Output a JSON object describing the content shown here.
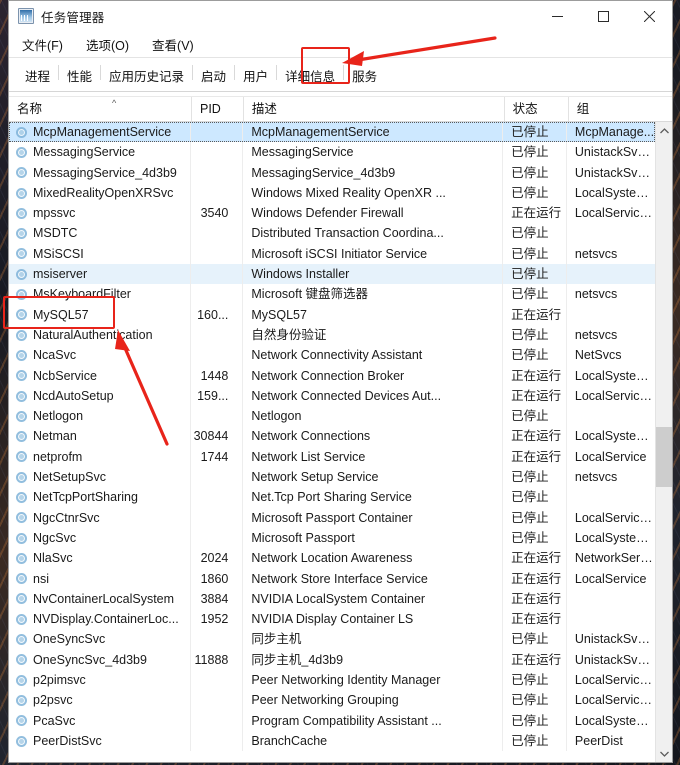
{
  "window": {
    "title": "任务管理器",
    "icon": "task-manager-icon",
    "minimize_label": "最小化",
    "maximize_label": "最大化",
    "close_label": "关闭"
  },
  "menubar": [
    {
      "label": "文件(F)"
    },
    {
      "label": "选项(O)"
    },
    {
      "label": "查看(V)"
    }
  ],
  "tabs": [
    {
      "label": "进程",
      "selected": false
    },
    {
      "label": "性能",
      "selected": false
    },
    {
      "label": "应用历史记录",
      "selected": false
    },
    {
      "label": "启动",
      "selected": false
    },
    {
      "label": "用户",
      "selected": false
    },
    {
      "label": "详细信息",
      "selected": false
    },
    {
      "label": "服务",
      "selected": true
    }
  ],
  "annotations": {
    "color": "#e8241a",
    "tab_box_target": "服务",
    "row_box_target": "MySQL57"
  },
  "table": {
    "columns": [
      {
        "key": "name",
        "label": "名称",
        "sort": "asc"
      },
      {
        "key": "pid",
        "label": "PID"
      },
      {
        "key": "desc",
        "label": "描述"
      },
      {
        "key": "status",
        "label": "状态"
      },
      {
        "key": "group",
        "label": "组"
      }
    ],
    "rows": [
      {
        "name": "McpManagementService",
        "pid": "",
        "desc": "McpManagementService",
        "status": "已停止",
        "group": "McpManage...",
        "state": "selected"
      },
      {
        "name": "MessagingService",
        "pid": "",
        "desc": "MessagingService",
        "status": "已停止",
        "group": "UnistackSvcG...",
        "state": ""
      },
      {
        "name": "MessagingService_4d3b9",
        "pid": "",
        "desc": "MessagingService_4d3b9",
        "status": "已停止",
        "group": "UnistackSvcG...",
        "state": ""
      },
      {
        "name": "MixedRealityOpenXRSvc",
        "pid": "",
        "desc": "Windows Mixed Reality OpenXR ...",
        "status": "已停止",
        "group": "LocalSystem...",
        "state": ""
      },
      {
        "name": "mpssvc",
        "pid": "3540",
        "desc": "Windows Defender Firewall",
        "status": "正在运行",
        "group": "LocalService...",
        "state": ""
      },
      {
        "name": "MSDTC",
        "pid": "",
        "desc": "Distributed Transaction Coordina...",
        "status": "已停止",
        "group": "",
        "state": ""
      },
      {
        "name": "MSiSCSI",
        "pid": "",
        "desc": "Microsoft iSCSI Initiator Service",
        "status": "已停止",
        "group": "netsvcs",
        "state": ""
      },
      {
        "name": "msiserver",
        "pid": "",
        "desc": "Windows Installer",
        "status": "已停止",
        "group": "",
        "state": "hover"
      },
      {
        "name": "MsKeyboardFilter",
        "pid": "",
        "desc": "Microsoft 键盘筛选器",
        "status": "已停止",
        "group": "netsvcs",
        "state": ""
      },
      {
        "name": "MySQL57",
        "pid": "160...",
        "desc": "MySQL57",
        "status": "正在运行",
        "group": "",
        "state": ""
      },
      {
        "name": "NaturalAuthentication",
        "pid": "",
        "desc": "自然身份验证",
        "status": "已停止",
        "group": "netsvcs",
        "state": ""
      },
      {
        "name": "NcaSvc",
        "pid": "",
        "desc": "Network Connectivity Assistant",
        "status": "已停止",
        "group": "NetSvcs",
        "state": ""
      },
      {
        "name": "NcbService",
        "pid": "1448",
        "desc": "Network Connection Broker",
        "status": "正在运行",
        "group": "LocalSystem...",
        "state": ""
      },
      {
        "name": "NcdAutoSetup",
        "pid": "159...",
        "desc": "Network Connected Devices Aut...",
        "status": "正在运行",
        "group": "LocalService...",
        "state": ""
      },
      {
        "name": "Netlogon",
        "pid": "",
        "desc": "Netlogon",
        "status": "已停止",
        "group": "",
        "state": ""
      },
      {
        "name": "Netman",
        "pid": "30844",
        "desc": "Network Connections",
        "status": "正在运行",
        "group": "LocalSystem...",
        "state": ""
      },
      {
        "name": "netprofm",
        "pid": "1744",
        "desc": "Network List Service",
        "status": "正在运行",
        "group": "LocalService",
        "state": ""
      },
      {
        "name": "NetSetupSvc",
        "pid": "",
        "desc": "Network Setup Service",
        "status": "已停止",
        "group": "netsvcs",
        "state": ""
      },
      {
        "name": "NetTcpPortSharing",
        "pid": "",
        "desc": "Net.Tcp Port Sharing Service",
        "status": "已停止",
        "group": "",
        "state": ""
      },
      {
        "name": "NgcCtnrSvc",
        "pid": "",
        "desc": "Microsoft Passport Container",
        "status": "已停止",
        "group": "LocalService...",
        "state": ""
      },
      {
        "name": "NgcSvc",
        "pid": "",
        "desc": "Microsoft Passport",
        "status": "已停止",
        "group": "LocalSystem...",
        "state": ""
      },
      {
        "name": "NlaSvc",
        "pid": "2024",
        "desc": "Network Location Awareness",
        "status": "正在运行",
        "group": "NetworkServ...",
        "state": ""
      },
      {
        "name": "nsi",
        "pid": "1860",
        "desc": "Network Store Interface Service",
        "status": "正在运行",
        "group": "LocalService",
        "state": ""
      },
      {
        "name": "NvContainerLocalSystem",
        "pid": "3884",
        "desc": "NVIDIA LocalSystem Container",
        "status": "正在运行",
        "group": "",
        "state": ""
      },
      {
        "name": "NVDisplay.ContainerLoc...",
        "pid": "1952",
        "desc": "NVIDIA Display Container LS",
        "status": "正在运行",
        "group": "",
        "state": ""
      },
      {
        "name": "OneSyncSvc",
        "pid": "",
        "desc": "同步主机",
        "status": "已停止",
        "group": "UnistackSvcG...",
        "state": ""
      },
      {
        "name": "OneSyncSvc_4d3b9",
        "pid": "11888",
        "desc": "同步主机_4d3b9",
        "status": "正在运行",
        "group": "UnistackSvcG...",
        "state": ""
      },
      {
        "name": "p2pimsvc",
        "pid": "",
        "desc": "Peer Networking Identity Manager",
        "status": "已停止",
        "group": "LocalService...",
        "state": ""
      },
      {
        "name": "p2psvc",
        "pid": "",
        "desc": "Peer Networking Grouping",
        "status": "已停止",
        "group": "LocalService...",
        "state": ""
      },
      {
        "name": "PcaSvc",
        "pid": "",
        "desc": "Program Compatibility Assistant ...",
        "status": "已停止",
        "group": "LocalSystem...",
        "state": ""
      },
      {
        "name": "PeerDistSvc",
        "pid": "",
        "desc": "BranchCache",
        "status": "已停止",
        "group": "PeerDist",
        "state": ""
      }
    ]
  },
  "scrollbar": {
    "up_arrow": "▲",
    "down_arrow": "▼"
  }
}
